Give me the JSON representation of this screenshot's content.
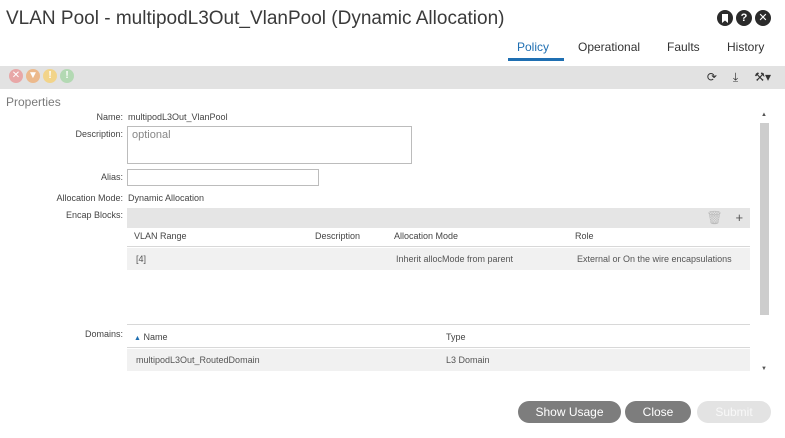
{
  "window": {
    "title": "VLAN Pool - multipodL3Out_VlanPool (Dynamic Allocation)",
    "header_icons": [
      "bookmark-icon",
      "help-icon",
      "close-icon"
    ]
  },
  "tabs": [
    {
      "label": "Policy",
      "active": true
    },
    {
      "label": "Operational",
      "active": false
    },
    {
      "label": "Faults",
      "active": false
    },
    {
      "label": "History",
      "active": false
    }
  ],
  "toolbar": {
    "fault_icons": [
      {
        "name": "critical-fault-icon",
        "glyph": "✕",
        "color": "#e8a7a7"
      },
      {
        "name": "major-fault-icon",
        "glyph": "▼",
        "color": "#ecb98c"
      },
      {
        "name": "minor-fault-icon",
        "glyph": "!",
        "color": "#f2d48a"
      },
      {
        "name": "warning-fault-icon",
        "glyph": "!",
        "color": "#b3d9b3"
      }
    ],
    "refresh_glyph": "⟳",
    "download_glyph": "⤓",
    "tools_glyph": "⚒▾"
  },
  "properties": {
    "section_label": "Properties",
    "name_label": "Name:",
    "name_value": "multipodL3Out_VlanPool",
    "description_label": "Description:",
    "description_placeholder": "optional",
    "alias_label": "Alias:",
    "alias_value": "",
    "allocation_label": "Allocation Mode:",
    "allocation_value": "Dynamic Allocation",
    "encap_label": "Encap Blocks:",
    "domains_label": "Domains:"
  },
  "encap_table": {
    "columns": [
      "VLAN Range",
      "Description",
      "Allocation Mode",
      "Role"
    ],
    "rows": [
      [
        "[4]",
        "",
        "Inherit allocMode from parent",
        "External or On the wire encapsulations"
      ]
    ],
    "delete_glyph": "🗑",
    "add_glyph": "+"
  },
  "domains_table": {
    "columns": [
      "Name",
      "Type"
    ],
    "sort_glyph": "▲",
    "rows": [
      [
        "multipodL3Out_RoutedDomain",
        "L3 Domain"
      ]
    ]
  },
  "scroll": {
    "up_glyph": "▲",
    "down_glyph": "▼"
  },
  "buttons": {
    "show_usage": "Show Usage",
    "close": "Close",
    "submit": "Submit"
  },
  "colors": {
    "accent": "#1f6fb2",
    "button_gray": "#7d7d7d",
    "button_disabled": "#e3e3e3"
  }
}
